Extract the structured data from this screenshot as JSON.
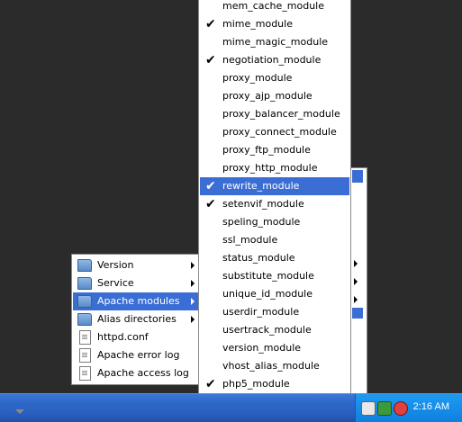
{
  "left_menu": {
    "items": [
      {
        "label": "Version",
        "icon": "folder-icon",
        "has_submenu": true
      },
      {
        "label": "Service",
        "icon": "folder-icon",
        "has_submenu": true
      },
      {
        "label": "Apache modules",
        "icon": "folder-icon",
        "has_submenu": true,
        "selected": true
      },
      {
        "label": "Alias directories",
        "icon": "folder-icon",
        "has_submenu": true
      },
      {
        "label": "httpd.conf",
        "icon": "document-icon",
        "has_submenu": false
      },
      {
        "label": "Apache error log",
        "icon": "document-icon",
        "has_submenu": false
      },
      {
        "label": "Apache access log",
        "icon": "document-icon",
        "has_submenu": false
      }
    ]
  },
  "modules_menu": {
    "check_glyph": "✔",
    "items": [
      {
        "label": "mem_cache_module",
        "checked": false
      },
      {
        "label": "mime_module",
        "checked": true
      },
      {
        "label": "mime_magic_module",
        "checked": false
      },
      {
        "label": "negotiation_module",
        "checked": true
      },
      {
        "label": "proxy_module",
        "checked": false
      },
      {
        "label": "proxy_ajp_module",
        "checked": false
      },
      {
        "label": "proxy_balancer_module",
        "checked": false
      },
      {
        "label": "proxy_connect_module",
        "checked": false
      },
      {
        "label": "proxy_ftp_module",
        "checked": false
      },
      {
        "label": "proxy_http_module",
        "checked": false
      },
      {
        "label": "rewrite_module",
        "checked": true,
        "selected": true
      },
      {
        "label": "setenvif_module",
        "checked": true
      },
      {
        "label": "speling_module",
        "checked": false
      },
      {
        "label": "ssl_module",
        "checked": false
      },
      {
        "label": "status_module",
        "checked": false
      },
      {
        "label": "substitute_module",
        "checked": false
      },
      {
        "label": "unique_id_module",
        "checked": false
      },
      {
        "label": "userdir_module",
        "checked": false
      },
      {
        "label": "usertrack_module",
        "checked": false
      },
      {
        "label": "version_module",
        "checked": false
      },
      {
        "label": "vhost_alias_module",
        "checked": false
      },
      {
        "label": "php5_module",
        "checked": true
      }
    ]
  },
  "taskbar": {
    "clock": "2:16 AM",
    "tray_icons": [
      "speaker-icon",
      "network-icon",
      "wamp-icon"
    ]
  },
  "colors": {
    "selection": "#3b6ed4",
    "taskbar": "#2a5fc0",
    "tray": "#1e9af0",
    "desktop": "#2b2b2b"
  }
}
